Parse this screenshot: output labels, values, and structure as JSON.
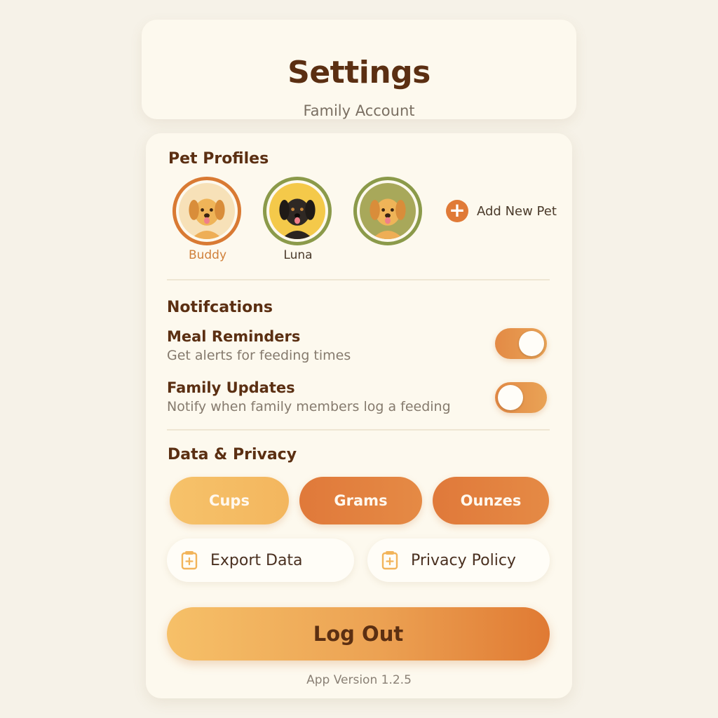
{
  "header": {
    "title": "Settings",
    "subtitle": "Family Account"
  },
  "pet_profiles": {
    "title": "Pet Profiles",
    "pets": [
      {
        "name": "Buddy",
        "selected": true,
        "icon": "golden-dog-icon"
      },
      {
        "name": "Luna",
        "selected": false,
        "icon": "black-dog-icon"
      },
      {
        "name": "",
        "selected": false,
        "icon": "golden-dog-icon"
      }
    ],
    "add_label": "Add New Pet"
  },
  "notifications": {
    "title": "Notifcations",
    "items": [
      {
        "title": "Meal Reminders",
        "description": "Get alerts for feeding times",
        "on": true
      },
      {
        "title": "Family Updates",
        "description": "Notify when family members log a feeding",
        "on": false
      }
    ]
  },
  "data_privacy": {
    "title": "Data & Privacy",
    "units": [
      "Cups",
      "Grams",
      "Ounzes"
    ],
    "export_label": "Export Data",
    "privacy_label": "Privacy Policy"
  },
  "logout_label": "Log Out",
  "version": "App Version 1.2.5",
  "colors": {
    "accent": "#e07a37",
    "title_brown": "#5b2f12",
    "card_bg": "#fdf9ee",
    "olive_ring": "#8b9a4a"
  }
}
